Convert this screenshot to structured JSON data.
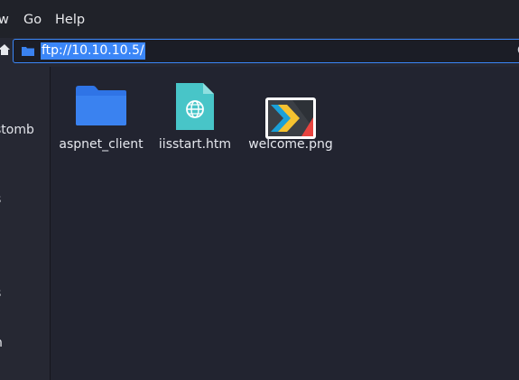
{
  "menu": {
    "view_label": "w",
    "go_label": "Go",
    "help_label": "Help"
  },
  "location": {
    "path": "ftp://10.10.10.5/",
    "suffix": "C"
  },
  "sidebar": {
    "items": [
      {
        "label": "stomb"
      },
      {
        "label": "s"
      },
      {
        "label": "s"
      },
      {
        "label": "n"
      }
    ]
  },
  "files": [
    {
      "name": "aspnet_client",
      "type": "folder"
    },
    {
      "name": "iisstart.htm",
      "type": "html"
    },
    {
      "name": "welcome.png",
      "type": "image"
    }
  ],
  "colors": {
    "accent": "#3b86f7",
    "folder": "#3a82f0",
    "html_icon": "#48c5c8"
  }
}
